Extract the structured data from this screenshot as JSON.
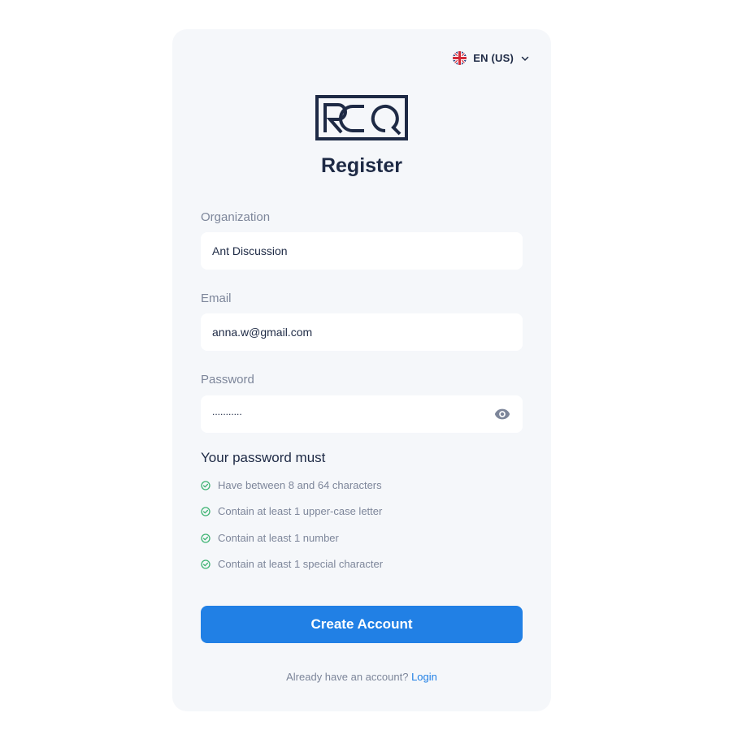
{
  "language": {
    "label": "EN (US)",
    "flag_icon": "uk-flag-icon",
    "chevron_icon": "chevron-down-icon"
  },
  "logo": {
    "text": "RCQ",
    "icon": "roq-logo"
  },
  "page": {
    "title": "Register"
  },
  "form": {
    "organization": {
      "label": "Organization",
      "value": "Ant Discussion"
    },
    "email": {
      "label": "Email",
      "value": "anna.w@gmail.com"
    },
    "password": {
      "label": "Password",
      "value": "...........",
      "toggle_icon": "eye-icon"
    }
  },
  "password_rules": {
    "title": "Your password must",
    "items": [
      {
        "text": "Have between 8 and 64 characters",
        "icon": "check-circle-icon"
      },
      {
        "text": "Contain at least 1 upper-case letter",
        "icon": "check-circle-icon"
      },
      {
        "text": "Contain at least 1 number",
        "icon": "check-circle-icon"
      },
      {
        "text": "Contain at least 1 special character",
        "icon": "check-circle-icon"
      }
    ]
  },
  "submit": {
    "label": "Create Account"
  },
  "footer": {
    "prompt": "Already have an account?",
    "link": "Login"
  },
  "colors": {
    "primary": "#2180e5",
    "brand_dark": "#1e2a45",
    "muted": "#7d869a",
    "success": "#3cb371",
    "card_bg": "#f5f7fa"
  }
}
